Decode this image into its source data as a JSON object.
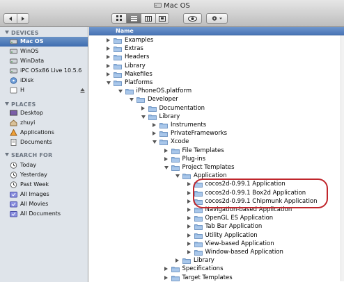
{
  "window": {
    "title": "Mac OS"
  },
  "toolbar": {
    "back_icon": "back-arrow-icon",
    "forward_icon": "forward-arrow-icon",
    "view_modes": [
      "icon-view-icon",
      "list-view-icon",
      "column-view-icon",
      "coverflow-view-icon"
    ],
    "active_view": "list-view-icon",
    "quicklook_icon": "eye-icon",
    "action_icon": "gear-icon"
  },
  "sidebar": {
    "devices_header": "DEVICES",
    "devices": [
      {
        "label": "Mac OS",
        "icon": "hard-drive-icon",
        "selected": true
      },
      {
        "label": "WinOS",
        "icon": "hard-drive-icon"
      },
      {
        "label": "WinData",
        "icon": "hard-drive-icon"
      },
      {
        "label": "iPC OSx86 Live 10.5.6",
        "icon": "hard-drive-icon"
      },
      {
        "label": "iDisk",
        "icon": "idisk-icon"
      },
      {
        "label": "H",
        "icon": "disk-icon",
        "eject": true
      }
    ],
    "places_header": "PLACES",
    "places": [
      {
        "label": "Desktop",
        "icon": "desktop-icon"
      },
      {
        "label": "zhuyi",
        "icon": "home-icon"
      },
      {
        "label": "Applications",
        "icon": "applications-icon"
      },
      {
        "label": "Documents",
        "icon": "documents-icon"
      }
    ],
    "search_header": "SEARCH FOR",
    "searches": [
      {
        "label": "Today",
        "icon": "clock-icon"
      },
      {
        "label": "Yesterday",
        "icon": "clock-icon"
      },
      {
        "label": "Past Week",
        "icon": "clock-icon"
      },
      {
        "label": "All Images",
        "icon": "smart-folder-icon"
      },
      {
        "label": "All Movies",
        "icon": "smart-folder-icon"
      },
      {
        "label": "All Documents",
        "icon": "smart-folder-icon"
      }
    ]
  },
  "list": {
    "column_name": "Name",
    "rows": [
      {
        "name": "Examples",
        "level": 0,
        "state": "closed"
      },
      {
        "name": "Extras",
        "level": 0,
        "state": "closed"
      },
      {
        "name": "Headers",
        "level": 0,
        "state": "closed"
      },
      {
        "name": "Library",
        "level": 0,
        "state": "closed"
      },
      {
        "name": "Makefiles",
        "level": 0,
        "state": "closed"
      },
      {
        "name": "Platforms",
        "level": 0,
        "state": "open"
      },
      {
        "name": "iPhoneOS.platform",
        "level": 1,
        "state": "open"
      },
      {
        "name": "Developer",
        "level": 2,
        "state": "open"
      },
      {
        "name": "Documentation",
        "level": 3,
        "state": "closed"
      },
      {
        "name": "Library",
        "level": 3,
        "state": "open"
      },
      {
        "name": "Instruments",
        "level": 4,
        "state": "closed"
      },
      {
        "name": "PrivateFrameworks",
        "level": 4,
        "state": "closed"
      },
      {
        "name": "Xcode",
        "level": 4,
        "state": "open"
      },
      {
        "name": "File Templates",
        "level": 5,
        "state": "closed"
      },
      {
        "name": "Plug-ins",
        "level": 5,
        "state": "closed"
      },
      {
        "name": "Project Templates",
        "level": 5,
        "state": "open"
      },
      {
        "name": "Application",
        "level": 6,
        "state": "open"
      },
      {
        "name": "cocos2d-0.99.1 Application",
        "level": 7,
        "state": "closed"
      },
      {
        "name": "cocos2d-0.99.1 Box2d Application",
        "level": 7,
        "state": "closed"
      },
      {
        "name": "cocos2d-0.99.1 Chipmunk Application",
        "level": 7,
        "state": "closed"
      },
      {
        "name": "Navigation-based Application",
        "level": 7,
        "state": "closed"
      },
      {
        "name": "OpenGL ES Application",
        "level": 7,
        "state": "closed"
      },
      {
        "name": "Tab Bar Application",
        "level": 7,
        "state": "closed"
      },
      {
        "name": "Utility Application",
        "level": 7,
        "state": "closed"
      },
      {
        "name": "View-based Application",
        "level": 7,
        "state": "closed"
      },
      {
        "name": "Window-based Application",
        "level": 7,
        "state": "closed"
      },
      {
        "name": "Library",
        "level": 6,
        "state": "closed"
      },
      {
        "name": "Specifications",
        "level": 5,
        "state": "closed"
      },
      {
        "name": "Target Templates",
        "level": 5,
        "state": "closed"
      }
    ]
  },
  "colors": {
    "highlight_outline": "#c0262c",
    "selection": "#4a75b6",
    "folder": "#7fa9d6"
  }
}
